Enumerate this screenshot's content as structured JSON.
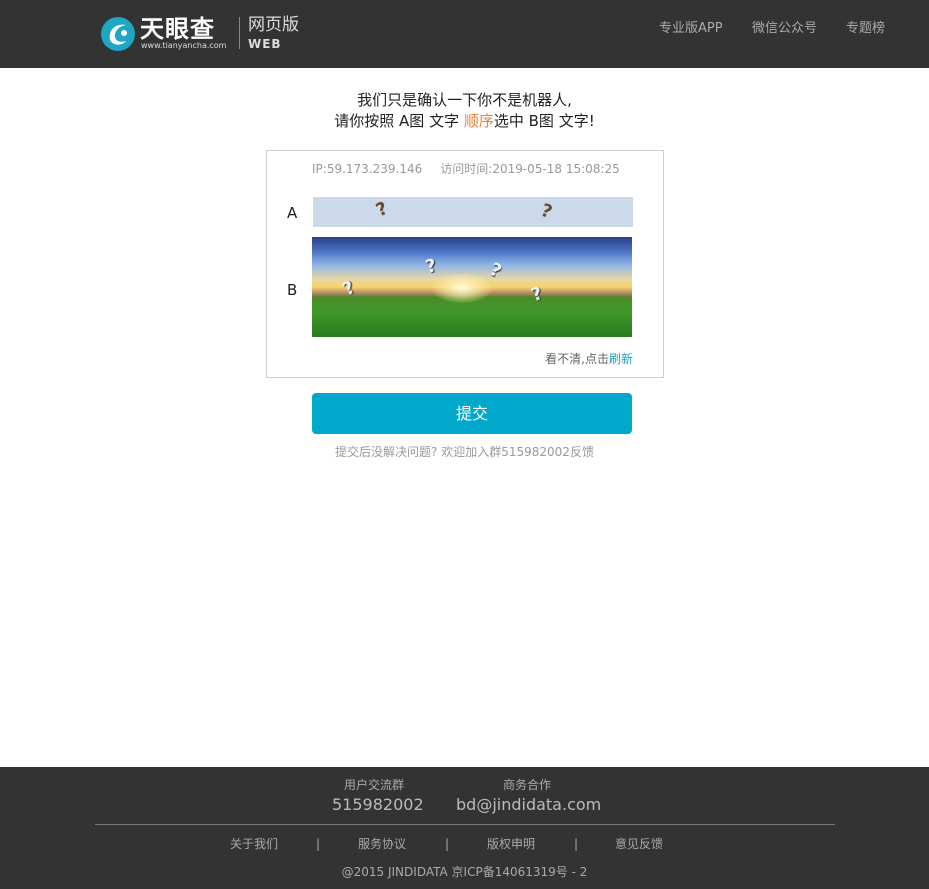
{
  "header": {
    "logo": {
      "name_cn": "天眼查",
      "url_text": "www.tianyancha.com",
      "edition_cn": "网页版",
      "edition_en": "WEB"
    },
    "nav": [
      {
        "label": "专业版APP"
      },
      {
        "label": "微信公众号"
      },
      {
        "label": "专题榜"
      }
    ]
  },
  "intro": {
    "line1": "我们只是确认一下你不是机器人,",
    "line2_before": "请你按照 A图 文字 ",
    "line2_highlight": "顺序",
    "line2_after": "选中 B图 文字!",
    "highlight_color": "#e8823a"
  },
  "captcha": {
    "ip_label": "IP:",
    "ip_value": "59.173.239.146",
    "time_label": "访问时间:",
    "time_value": "2019-05-18 15:08:25",
    "label_a": "A",
    "label_b": "B",
    "a_glyphs": [
      "?",
      "?"
    ],
    "b_glyphs": [
      "?",
      "?",
      "?",
      "?"
    ],
    "refresh_prefix": "看不清,点击",
    "refresh_link": "刷新"
  },
  "submit": {
    "label": "提交",
    "color": "#00a9cc"
  },
  "feedback_text": "提交后没解决问题? 欢迎加入群515982002反馈",
  "footer": {
    "group_title": "用户交流群",
    "group_value": "515982002",
    "biz_title": "商务合作",
    "biz_value": "bd@jindidata.com",
    "links": [
      {
        "label": "关于我们"
      },
      {
        "label": "服务协议"
      },
      {
        "label": "版权申明"
      },
      {
        "label": "意见反馈"
      }
    ],
    "separator": "|",
    "copyright": "@2015 JINDIDATA 京ICP备14061319号 - 2"
  }
}
